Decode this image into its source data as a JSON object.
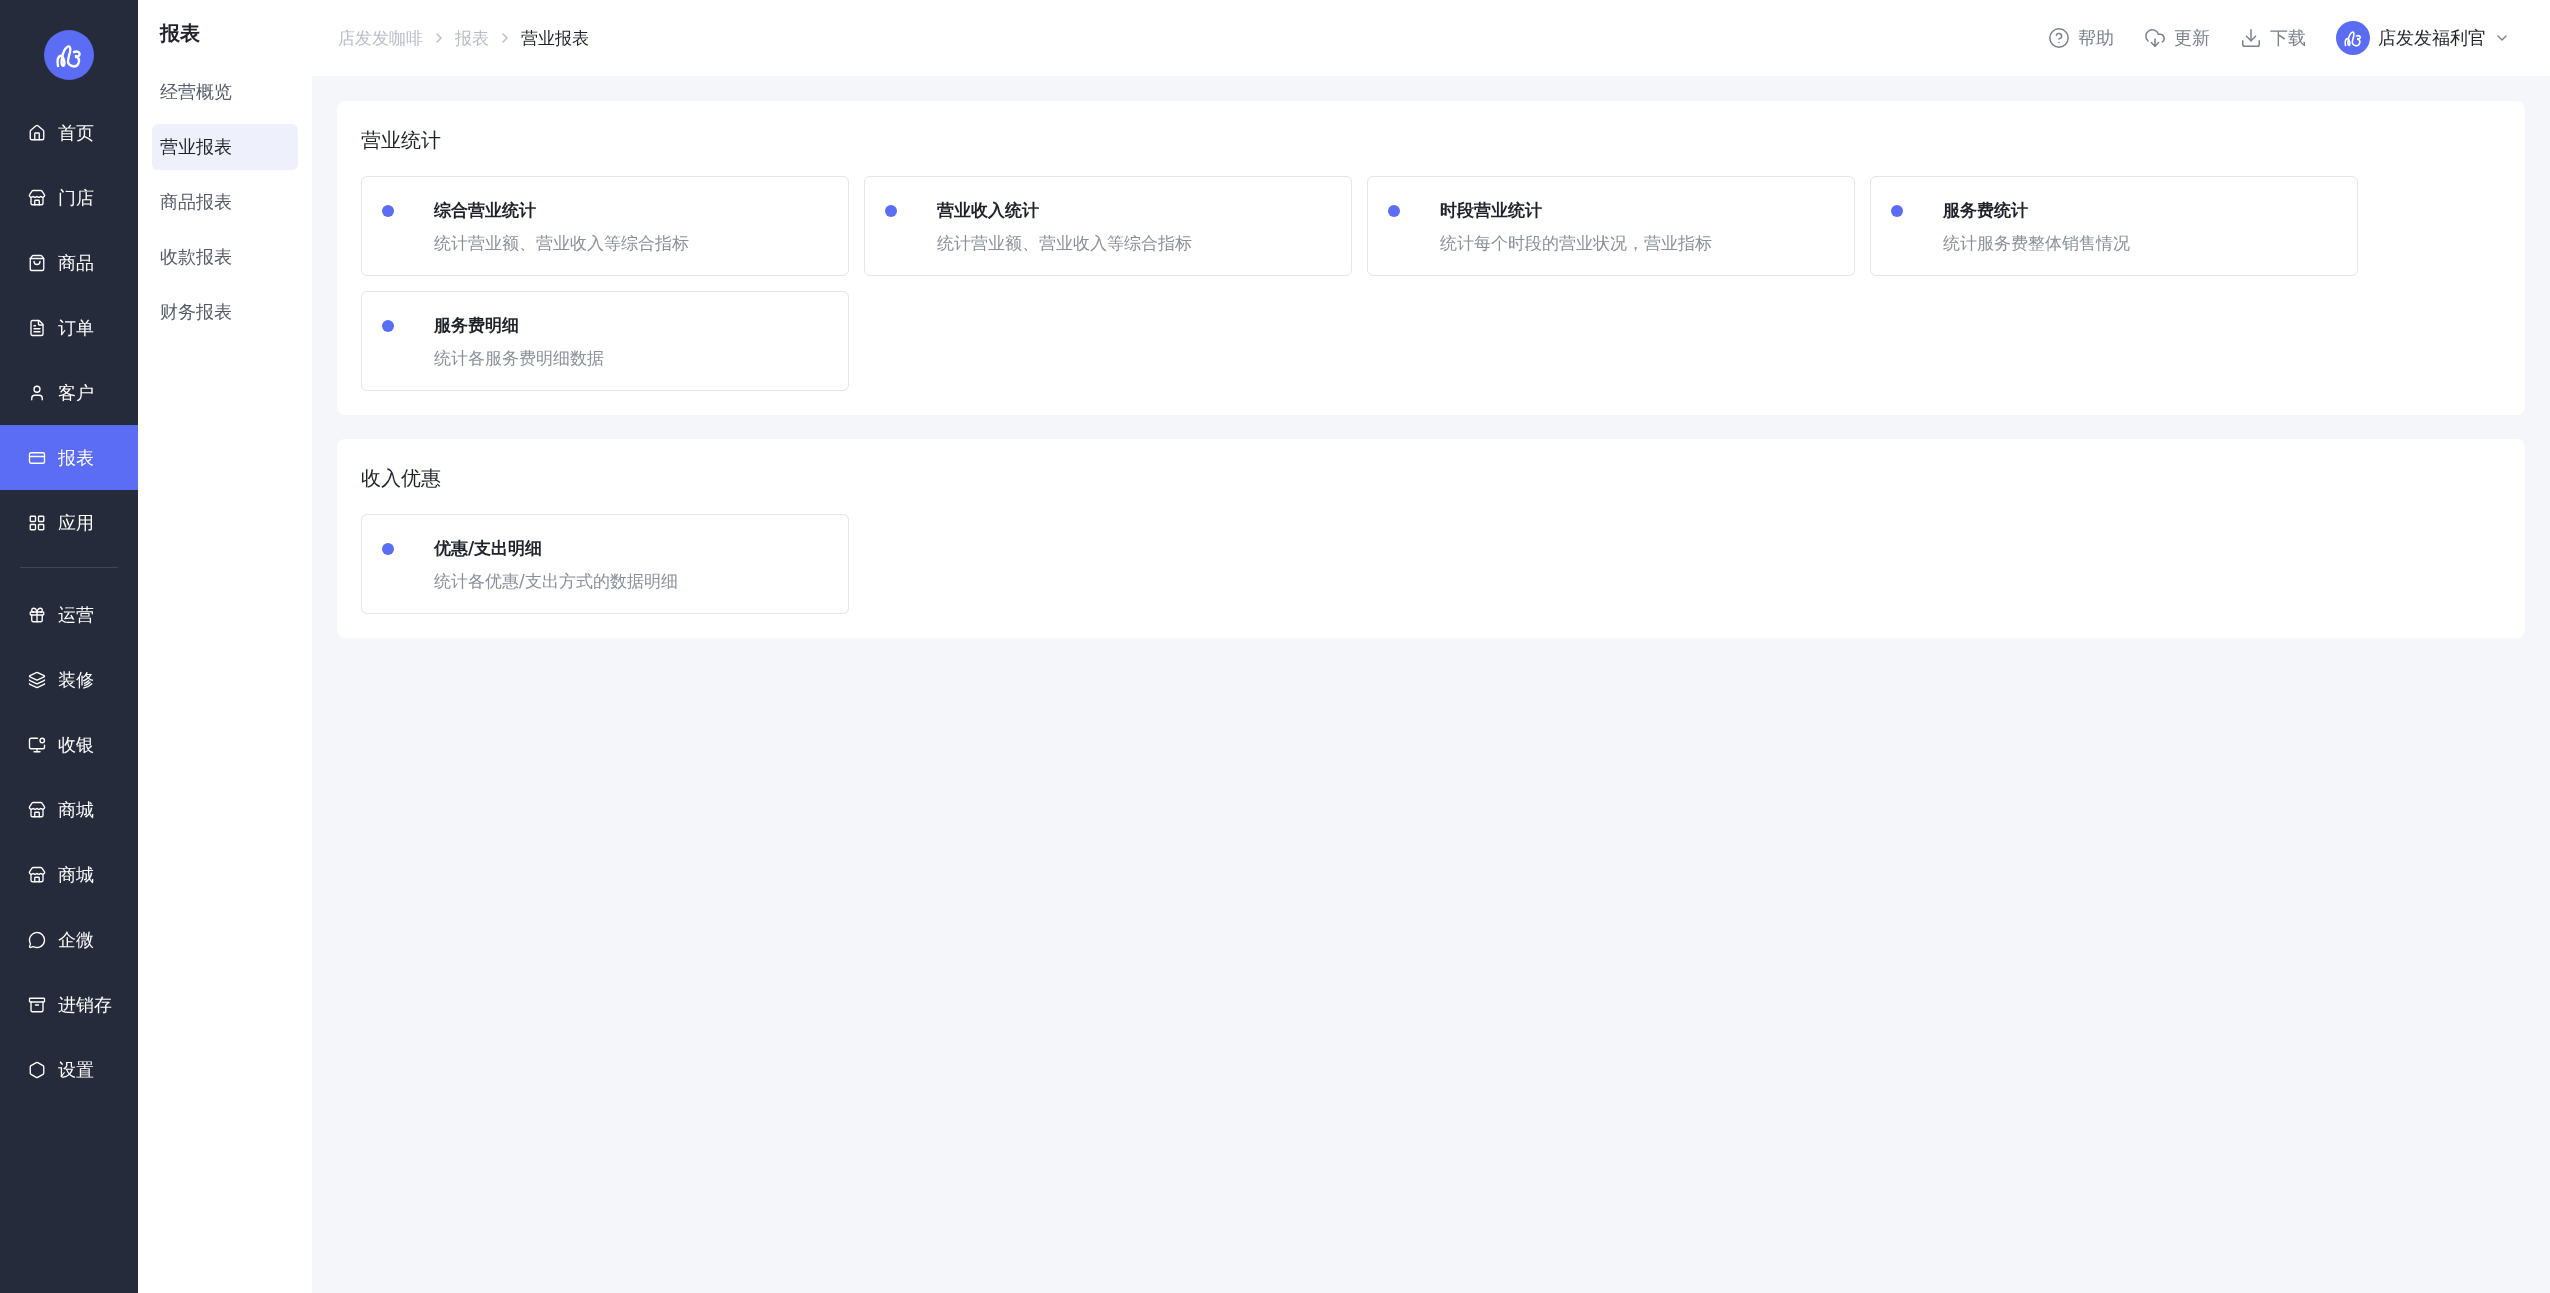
{
  "sidebar": {
    "groups": [
      [
        {
          "label": "首页",
          "selected": false
        },
        {
          "label": "门店",
          "selected": false
        },
        {
          "label": "商品",
          "selected": false
        },
        {
          "label": "订单",
          "selected": false
        },
        {
          "label": "客户",
          "selected": false
        },
        {
          "label": "报表",
          "selected": true
        },
        {
          "label": "应用",
          "selected": false
        }
      ],
      [
        {
          "label": "运营",
          "selected": false
        },
        {
          "label": "装修",
          "selected": false
        },
        {
          "label": "收银",
          "selected": false
        },
        {
          "label": "商城",
          "selected": false
        },
        {
          "label": "商城",
          "selected": false
        },
        {
          "label": "企微",
          "selected": false
        },
        {
          "label": "进销存",
          "selected": false
        },
        {
          "label": "设置",
          "selected": false
        }
      ]
    ]
  },
  "sub_nav": {
    "title": "报表",
    "items": [
      {
        "label": "经营概览",
        "selected": false
      },
      {
        "label": "营业报表",
        "selected": true
      },
      {
        "label": "商品报表",
        "selected": false
      },
      {
        "label": "收款报表",
        "selected": false
      },
      {
        "label": "财务报表",
        "selected": false
      }
    ]
  },
  "breadcrumb": [
    "店发发咖啡",
    "报表",
    "营业报表"
  ],
  "header": {
    "actions": [
      "帮助",
      "更新",
      "下载"
    ],
    "user": {
      "name": "店发发福利官"
    }
  },
  "sections": [
    {
      "title": "营业统计",
      "cards": [
        {
          "title": "综合营业统计",
          "description": "统计营业额、营业收入等综合指标"
        },
        {
          "title": "营业收入统计",
          "description": "统计营业额、营业收入等综合指标"
        },
        {
          "title": "时段营业统计",
          "description": "统计每个时段的营业状况，营业指标"
        },
        {
          "title": "服务费统计",
          "description": "统计服务费整体销售情况"
        },
        {
          "title": "服务费明细",
          "description": "统计各服务费明细数据"
        }
      ]
    },
    {
      "title": "收入优惠",
      "cards": [
        {
          "title": "优惠/支出明细",
          "description": "统计各优惠/支出方式的数据明细"
        }
      ]
    }
  ]
}
